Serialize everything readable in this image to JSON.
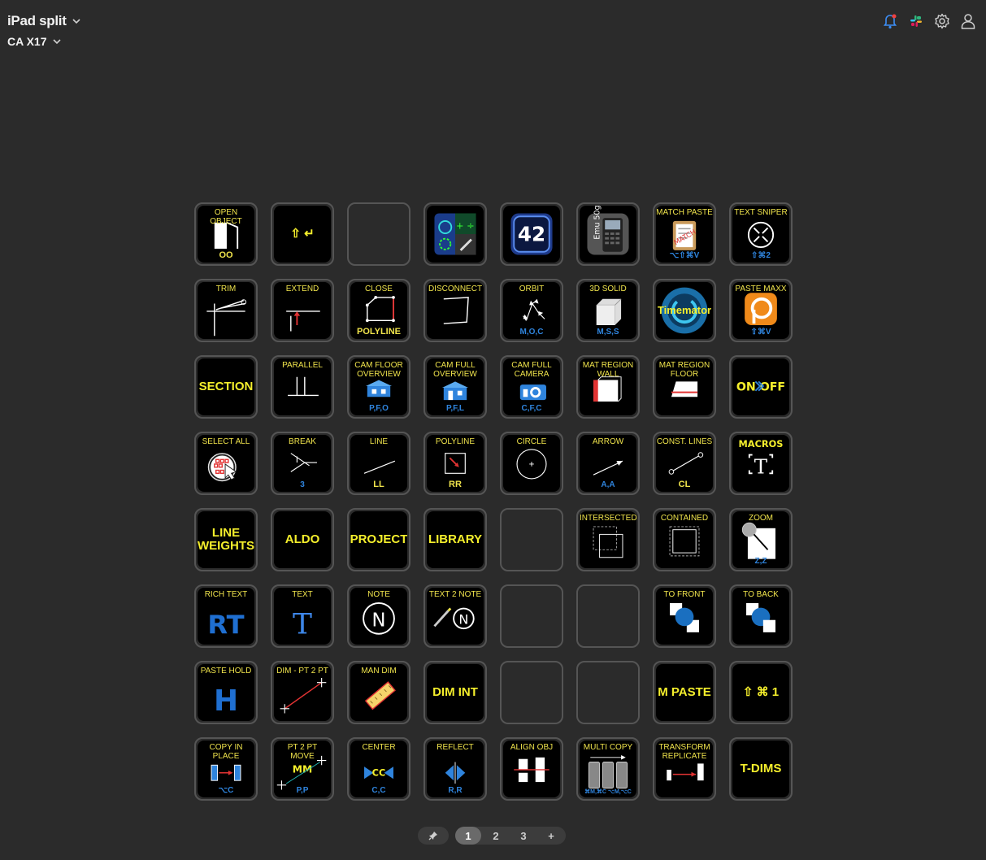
{
  "header": {
    "profile_name": "iPad split",
    "app_name": "CA X17"
  },
  "top_icons": [
    "bell-icon",
    "slack-icon",
    "gear-icon",
    "user-icon"
  ],
  "colors": {
    "label": "#f0e44c",
    "shortcut": "#2f84dd",
    "key_bg": "#000000",
    "page_bg": "#2b2b2b"
  },
  "keys": [
    {
      "label": "OPEN OBJECT",
      "sub": "OO",
      "sub_style": "y"
    },
    {
      "big": "⇧ ↵"
    },
    {
      "empty": true
    },
    {
      "label": ""
    },
    {
      "big": "42"
    },
    {
      "label": ""
    },
    {
      "label": "MATCH PASTE",
      "sub": "⌥⇧⌘V"
    },
    {
      "label": "TEXT SNIPER",
      "sub": "⇧⌘2"
    },
    {
      "label": "TRIM"
    },
    {
      "label": "EXTEND"
    },
    {
      "label": "CLOSE",
      "sub": "POLYLINE",
      "sub_style": "y"
    },
    {
      "label": "DISCONNECT"
    },
    {
      "label": "ORBIT",
      "sub": "M,O,C"
    },
    {
      "label": "3D SOLID",
      "sub": "M,S,S"
    },
    {
      "big": "Timemator"
    },
    {
      "label": "PASTE MAXX",
      "sub": "⇧⌘V"
    },
    {
      "big": "SECTION"
    },
    {
      "label": "PARALLEL"
    },
    {
      "label": "CAM FLOOR\nOVERVIEW",
      "sub": "P,F,O"
    },
    {
      "label": "CAM FULL\nOVERVIEW",
      "sub": "P,F,L"
    },
    {
      "label": "CAM FULL\nCAMERA",
      "sub": "C,F,C"
    },
    {
      "label": "MAT REGION\nWALL"
    },
    {
      "label": "MAT REGION\nFLOOR"
    },
    {
      "big": "ON OFF"
    },
    {
      "label": "SELECT ALL"
    },
    {
      "label": "BREAK",
      "sub": "3"
    },
    {
      "label": "LINE",
      "sub": "LL",
      "sub_style": "y"
    },
    {
      "label": "POLYLINE",
      "sub": "RR",
      "sub_style": "y"
    },
    {
      "label": "CIRCLE"
    },
    {
      "label": "ARROW",
      "sub": "A,A"
    },
    {
      "label": "CONST. LINES",
      "sub": "CL",
      "sub_style": "y"
    },
    {
      "big": "MACROS"
    },
    {
      "big": "LINE\nWEIGHTS"
    },
    {
      "big": "ALDO"
    },
    {
      "big": "PROJECT"
    },
    {
      "big": "LIBRARY"
    },
    {
      "empty": true
    },
    {
      "label": "INTERSECTED"
    },
    {
      "label": "CONTAINED"
    },
    {
      "label": "ZOOM",
      "sub": "Z,Z"
    },
    {
      "label": "RICH TEXT",
      "glyph": "RT"
    },
    {
      "label": "TEXT",
      "glyph": "T"
    },
    {
      "label": "NOTE"
    },
    {
      "label": "TEXT 2 NOTE"
    },
    {
      "empty": true
    },
    {
      "empty": true
    },
    {
      "label": "TO FRONT"
    },
    {
      "label": "TO BACK"
    },
    {
      "label": "PASTE HOLD",
      "glyph": "H"
    },
    {
      "label": "DIM - PT 2 PT"
    },
    {
      "label": "MAN DIM"
    },
    {
      "big": "DIM INT"
    },
    {
      "empty": true
    },
    {
      "empty": true
    },
    {
      "big": "M PASTE"
    },
    {
      "big": "⇧ ⌘ 1"
    },
    {
      "label": "COPY IN\nPLACE",
      "sub": "⌥C"
    },
    {
      "label": "PT 2 PT\nMOVE",
      "sub": "P,P",
      "inner": "MM"
    },
    {
      "label": "CENTER",
      "sub": "C,C",
      "inner": "CC"
    },
    {
      "label": "REFLECT",
      "sub": "R,R"
    },
    {
      "label": "ALIGN OBJ"
    },
    {
      "label": "MULTI COPY",
      "sub": "⌘M,⌘C ⌥M,⌥C"
    },
    {
      "label": "TRANSFORM\nREPLICATE"
    },
    {
      "big": "T-DIMS"
    }
  ],
  "pager": {
    "pin_icon": "pin-icon",
    "pages": [
      "1",
      "2",
      "3"
    ],
    "active": "1",
    "add": "+"
  }
}
